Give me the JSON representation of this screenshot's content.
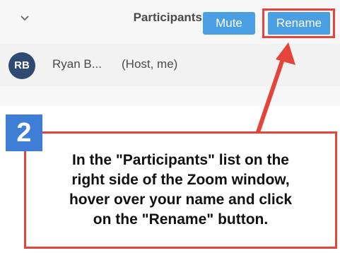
{
  "panel": {
    "title": "Participants (1)"
  },
  "participant": {
    "initials": "RB",
    "name": "Ryan B...",
    "role": "(Host, me)",
    "mute_label": "Mute",
    "rename_label": "Rename"
  },
  "annotation": {
    "step_number": "2",
    "text": "In the \"Participants\" list on the\nright side of the Zoom window,\nhover over your name and click\non the \"Rename\" button."
  },
  "colors": {
    "accent_button": "#4a9fe4",
    "highlight": "#e4443c",
    "avatar": "#2e4a72",
    "badge": "#3f7ed6"
  }
}
